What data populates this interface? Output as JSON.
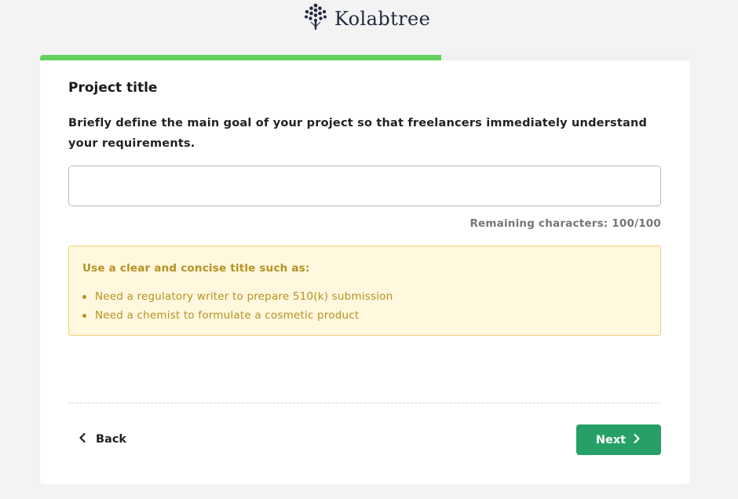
{
  "brand": {
    "name": "Kolabtree",
    "logo_icon": "tree-logo-icon",
    "text_color": "#1f2a3c"
  },
  "progress": {
    "fraction": 0.617,
    "fill_color": "#62d25e"
  },
  "form": {
    "title": "Project title",
    "description": "Briefly define the main goal of your project so that freelancers immediately understand your requirements.",
    "input": {
      "value": "",
      "placeholder": ""
    },
    "remaining": "Remaining characters: 100/100"
  },
  "tips": {
    "heading": "Use a clear and concise title such as:",
    "items": [
      "Need a regulatory writer to prepare 510(k) submission",
      "Need a chemist to formulate a cosmetic product"
    ],
    "color": "#b59220",
    "background": "#fff7de"
  },
  "nav": {
    "back_label": "Back",
    "back_icon": "chevron-left-icon",
    "next_label": "Next",
    "next_icon": "chevron-right-icon",
    "next_color": "#27a067"
  }
}
